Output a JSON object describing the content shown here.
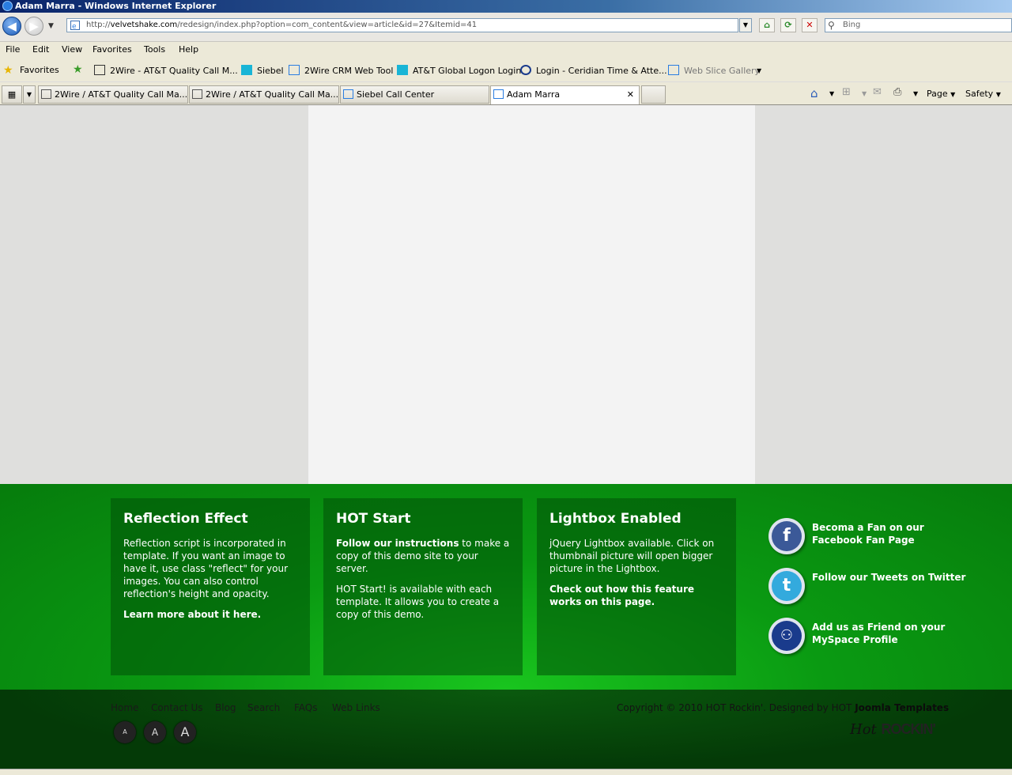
{
  "window": {
    "title": "Adam Marra - Windows Internet Explorer"
  },
  "address": {
    "url_prefix": "http://",
    "url_host": "velvetshake.com",
    "url_path": "/redesign/index.php?option=com_content&view=article&id=27&Itemid=41"
  },
  "search": {
    "placeholder": "Bing"
  },
  "menu": [
    "File",
    "Edit",
    "View",
    "Favorites",
    "Tools",
    "Help"
  ],
  "favorites": {
    "label": "Favorites",
    "items": [
      "2Wire - AT&T Quality Call M...",
      "Siebel",
      "2Wire CRM Web Tool",
      "AT&T Global Logon Login",
      "Login - Ceridian Time & Atte...",
      "Web Slice Gallery"
    ]
  },
  "tabs": [
    "2Wire / AT&T Quality Call Ma...",
    "2Wire / AT&T Quality Call Ma...",
    "Siebel Call Center",
    "Adam Marra"
  ],
  "toolbar_right": {
    "page": "Page",
    "safety": "Safety"
  },
  "boxes": [
    {
      "title": "Reflection Effect",
      "p1": "Reflection script is incorporated in template. If you want an image to have it, use class \"reflect\" for your images. You can also control reflection's height and opacity.",
      "p2": "Learn more about it here."
    },
    {
      "title": "HOT Start",
      "p1_bold": "Follow our instructions",
      "p1_rest": " to make a copy of this demo site to your server.",
      "p2": "HOT Start! is available with each template. It allows you to create a copy of this demo."
    },
    {
      "title": "Lightbox Enabled",
      "p1": "jQuery Lightbox available. Click on thumbnail picture will open bigger picture in the Lightbox.",
      "p2": "Check out how this feature works on this page."
    }
  ],
  "social": [
    {
      "text": "Becoma a Fan on our Facebook Fan Page",
      "icon": "facebook-icon",
      "color": "#3b5998"
    },
    {
      "text": "Follow our Tweets on Twitter",
      "icon": "twitter-icon",
      "color": "#33aadd"
    },
    {
      "text": "Add us as Friend on your MySpace Profile",
      "icon": "myspace-icon",
      "color": "#1a3b8c"
    }
  ],
  "footer": {
    "links": [
      "Home",
      "Contact Us",
      "Blog",
      "Search",
      "FAQs",
      "Web Links"
    ],
    "font_sizes": [
      "A",
      "A",
      "A"
    ],
    "copyright_text": "Copyright © 2010 HOT Rockin'. Designed by HOT ",
    "copyright_link": "Joomla Templates",
    "logo_script": "Hot",
    "logo_bold": "ROCKIN'"
  },
  "colors": {
    "green_dark": "#067c0c",
    "green_light": "#19c51e"
  }
}
